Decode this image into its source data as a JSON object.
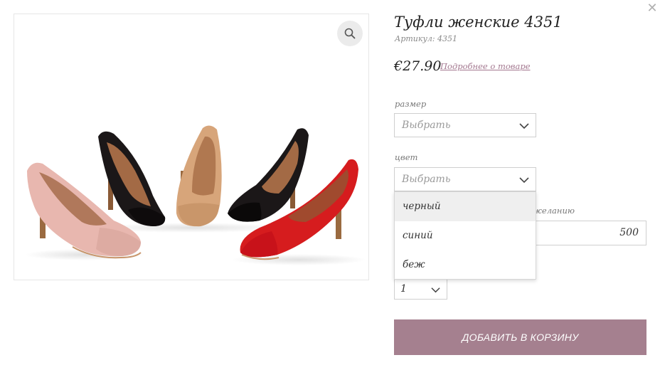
{
  "close": {
    "icon": "close-icon",
    "glyph": "✕"
  },
  "product": {
    "title": "Туфли женские 4351",
    "sku": "Артикул: 4351",
    "price": "€27.90",
    "details_link": "Подробнее о товаре",
    "image_alt_icons": [
      "zoom-icon"
    ]
  },
  "size": {
    "label": "размер",
    "placeholder": "Выбрать"
  },
  "color": {
    "label": "цвет",
    "placeholder": "Выбрать",
    "options": [
      "черный",
      "синий",
      "беж"
    ],
    "highlighted": "черный"
  },
  "amount": {
    "label_partial": "желанию)",
    "value": "500"
  },
  "quantity": {
    "value": "1"
  },
  "cart": {
    "button_label": "ДОБАВИТЬ В КОРЗИНУ"
  },
  "colors": {
    "accent": "#a5808f",
    "link": "#a3778f",
    "border": "#cfcfcf"
  }
}
